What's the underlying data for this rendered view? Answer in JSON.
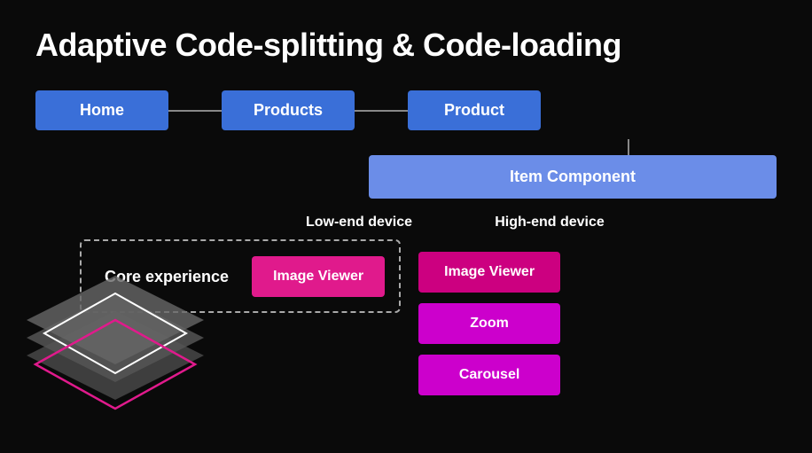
{
  "title": "Adaptive Code-splitting & Code-loading",
  "routes": {
    "home": "Home",
    "products": "Products",
    "product": "Product"
  },
  "item_component": "Item Component",
  "device_labels": {
    "low": "Low-end device",
    "high": "High-end device"
  },
  "core_experience": "Core experience",
  "image_viewer_low": "Image Viewer",
  "image_viewer_high": "Image Viewer",
  "zoom": "Zoom",
  "carousel": "Carousel",
  "colors": {
    "blue_dark": "#3a6fd8",
    "blue_light": "#6b8de8",
    "pink": "#e01a8c",
    "magenta": "#cc00cc"
  }
}
